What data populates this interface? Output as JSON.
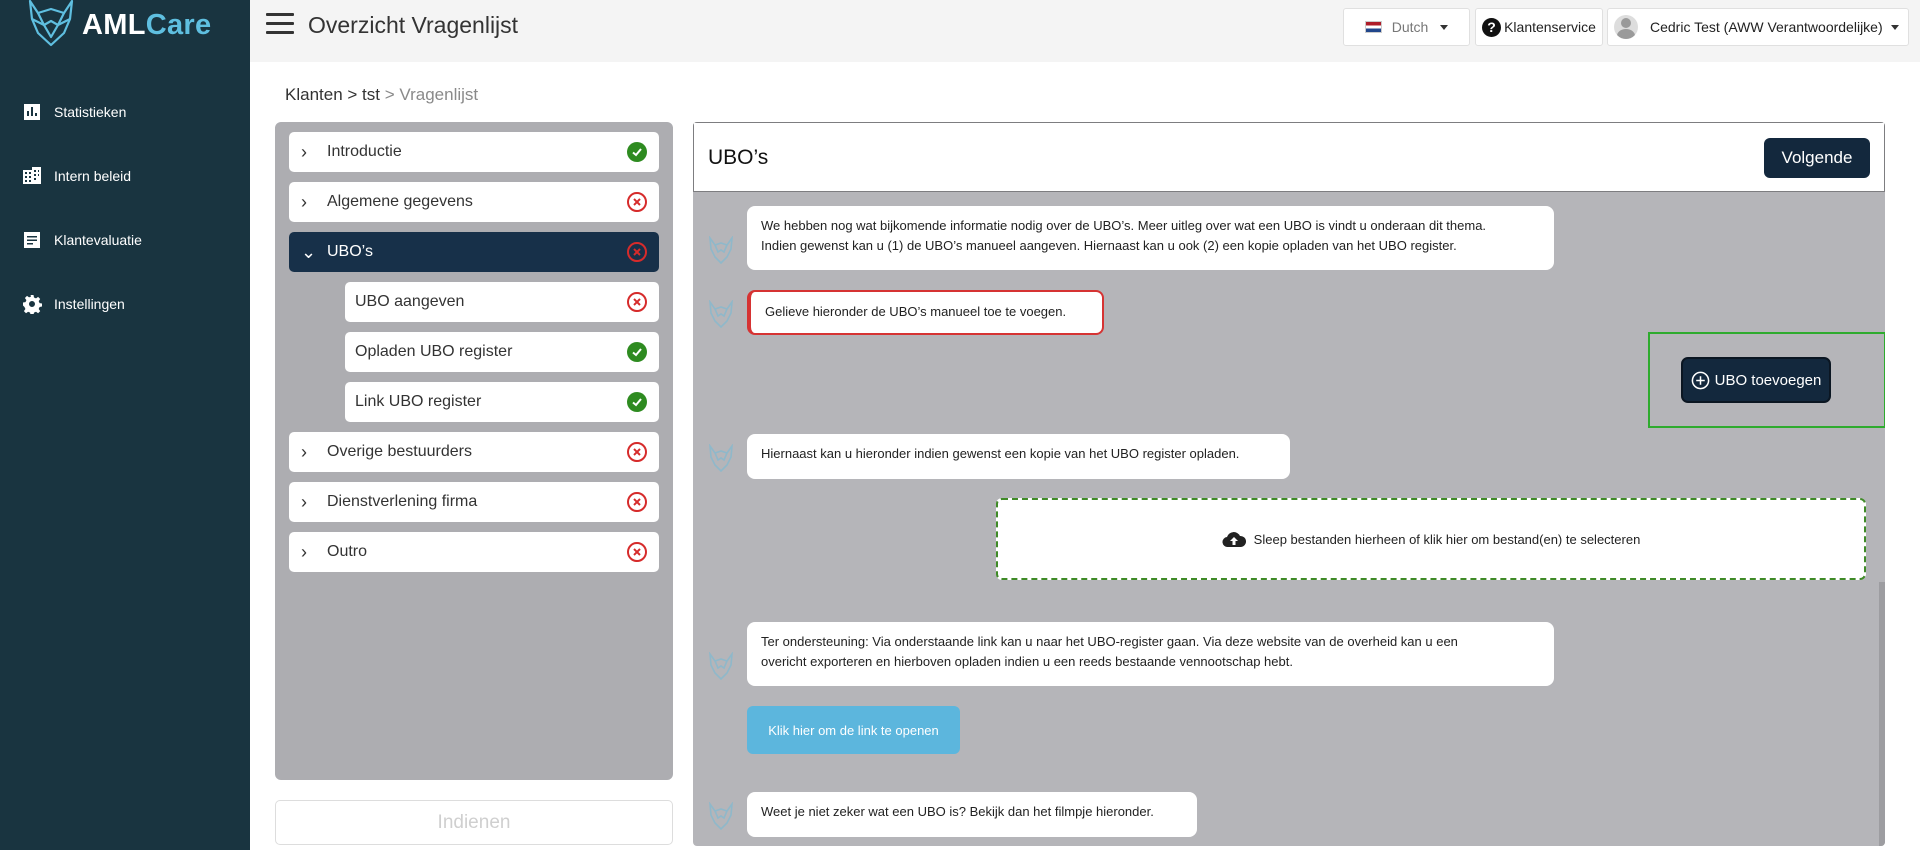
{
  "sidebar": {
    "logo_aml": "AML",
    "logo_care": "Care",
    "items": [
      {
        "label": "Statistieken",
        "icon": "chart-icon"
      },
      {
        "label": "Intern beleid",
        "icon": "building-icon"
      },
      {
        "label": "Klantevaluatie",
        "icon": "document-icon"
      },
      {
        "label": "Instellingen",
        "icon": "gear-icon"
      }
    ]
  },
  "header": {
    "title": "Overzicht Vragenlijst",
    "language": "Dutch",
    "support": "Klantenservice",
    "user": "Cedric Test (AWW Verantwoordelijke)"
  },
  "breadcrumb": {
    "part1": "Klanten",
    "sep1": " > ",
    "part2": "tst",
    "sep2": " > ",
    "part3": "Vragenlijst"
  },
  "sections": [
    {
      "label": "Introductie",
      "status": "complete"
    },
    {
      "label": "Algemene gegevens",
      "status": "incomplete"
    },
    {
      "label": "UBO’s",
      "status": "incomplete",
      "expanded": true
    },
    {
      "label": "UBO aangeven",
      "status": "incomplete"
    },
    {
      "label": "Opladen UBO register",
      "status": "complete"
    },
    {
      "label": "Link UBO register",
      "status": "complete"
    },
    {
      "label": "Overige bestuurders",
      "status": "incomplete"
    },
    {
      "label": "Dienstverlening firma",
      "status": "incomplete"
    },
    {
      "label": "Outro",
      "status": "incomplete"
    }
  ],
  "submit_label": "Indienen",
  "panel": {
    "title": "UBO’s",
    "next_label": "Volgende",
    "messages": [
      "We hebben nog wat bijkomende informatie nodig over de UBO’s. Meer uitleg over wat een UBO is vindt u onderaan dit thema.",
      "Indien gewenst kan u (1) de UBO’s manueel aangeven. Hiernaast kan u ook (2) een kopie opladen van het UBO register.",
      "Gelieve hieronder de UBO’s manueel toe te voegen.",
      "Hiernaast kan u hieronder indien gewenst een kopie van het UBO register opladen.",
      "Ter ondersteuning: Via onderstaande link kan u naar het UBO-register gaan. Via deze website van de overheid kan u een",
      "overicht exporteren en hierboven opladen indien u een reeds bestaande vennootschap hebt.",
      "Weet je niet zeker wat een UBO is? Bekijk dan het filmpje hieronder."
    ],
    "add_ubo_label": "UBO toevoegen",
    "dropzone_label": "Sleep bestanden hierheen of klik hier om bestand(en) te selecteren",
    "link_label": "Klik hier om de link te openen"
  },
  "colors": {
    "sidebar": "#193440",
    "brand_care": "#5fbfe0",
    "primary": "#13283d",
    "success": "#2e8b20",
    "error": "#d62b2b",
    "link_button": "#5cb6dd"
  }
}
